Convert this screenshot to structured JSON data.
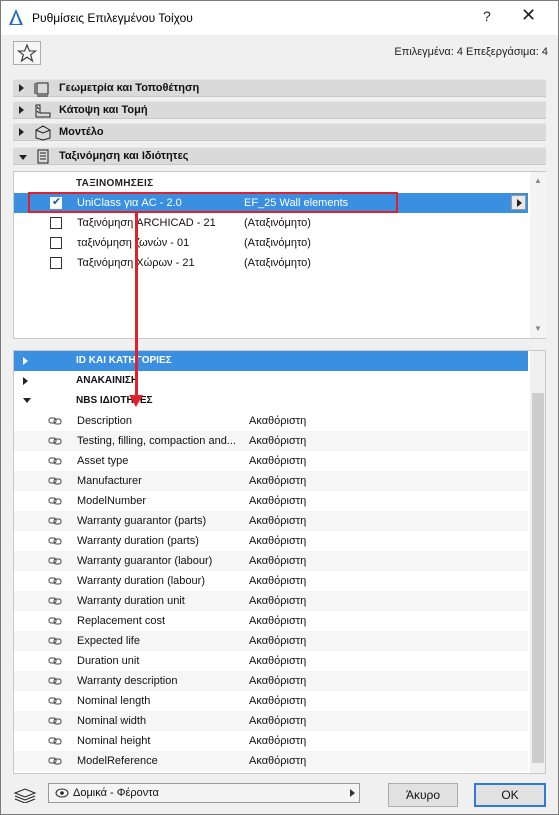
{
  "window": {
    "title": "Ρυθμίσεις Επιλεγμένου Τοίχου",
    "help_label": "?",
    "close_label": "✕"
  },
  "toolbar": {
    "selected_info": "Επιλεγμένα: 4 Επεξεργάσιμα: 4"
  },
  "panels": [
    {
      "label": "Γεωμετρία και Τοποθέτηση",
      "icon": "wall-geometry-icon",
      "expanded": false
    },
    {
      "label": "Κάτοψη και Τομή",
      "icon": "floorplan-section-icon",
      "expanded": false
    },
    {
      "label": "Μοντέλο",
      "icon": "model-icon",
      "expanded": false
    },
    {
      "label": "Ταξινόμηση και Ιδιότητες",
      "icon": "classification-icon",
      "expanded": true
    }
  ],
  "classifications": {
    "header": "ΤΑΞΙΝΟΜΗΣΕΙΣ",
    "rows": [
      {
        "name": "UniClass για AC - 2.0",
        "value": "EF_25 Wall elements",
        "checked": true,
        "selected": true
      },
      {
        "name": "Ταξινόμηση ARCHICAD - 21",
        "value": "(Αταξινόμητο)",
        "checked": false,
        "selected": false
      },
      {
        "name": "ταξινόμηση ζωνών - 01",
        "value": "(Αταξινόμητο)",
        "checked": false,
        "selected": false
      },
      {
        "name": "Ταξινόμηση Χώρων - 21",
        "value": "(Αταξινόμητο)",
        "checked": false,
        "selected": false
      }
    ]
  },
  "property_groups": [
    {
      "label": "ID ΚΑΙ ΚΑΤΗΓΟΡΙΕΣ",
      "expanded": false,
      "selected": true
    },
    {
      "label": "ΑΝΑΚΑΙΝΙΣΗ",
      "expanded": false,
      "selected": false
    },
    {
      "label": "NBS ΙΔΙΟΤΗΤΕΣ",
      "expanded": true,
      "selected": false
    }
  ],
  "properties": [
    {
      "name": "Description",
      "value": "Ακαθόριστη"
    },
    {
      "name": "Testing, filling, compaction and...",
      "value": "Ακαθόριστη"
    },
    {
      "name": "Asset type",
      "value": "Ακαθόριστη"
    },
    {
      "name": "Manufacturer",
      "value": "Ακαθόριστη"
    },
    {
      "name": "ModelNumber",
      "value": "Ακαθόριστη"
    },
    {
      "name": "Warranty guarantor (parts)",
      "value": "Ακαθόριστη"
    },
    {
      "name": "Warranty duration (parts)",
      "value": "Ακαθόριστη"
    },
    {
      "name": "Warranty guarantor (labour)",
      "value": "Ακαθόριστη"
    },
    {
      "name": "Warranty duration (labour)",
      "value": "Ακαθόριστη"
    },
    {
      "name": "Warranty duration unit",
      "value": "Ακαθόριστη"
    },
    {
      "name": "Replacement cost",
      "value": "Ακαθόριστη"
    },
    {
      "name": "Expected life",
      "value": "Ακαθόριστη"
    },
    {
      "name": "Duration unit",
      "value": "Ακαθόριστη"
    },
    {
      "name": "Warranty description",
      "value": "Ακαθόριστη"
    },
    {
      "name": "Nominal length",
      "value": "Ακαθόριστη"
    },
    {
      "name": "Nominal width",
      "value": "Ακαθόριστη"
    },
    {
      "name": "Nominal height",
      "value": "Ακαθόριστη"
    },
    {
      "name": "ModelReference",
      "value": "Ακαθόριστη"
    }
  ],
  "footer": {
    "view_select": "Δομικά - Φέροντα",
    "cancel_label": "Άκυρο",
    "ok_label": "OK"
  },
  "colors": {
    "selection": "#3a8fe0",
    "annotation": "#e0202a"
  }
}
